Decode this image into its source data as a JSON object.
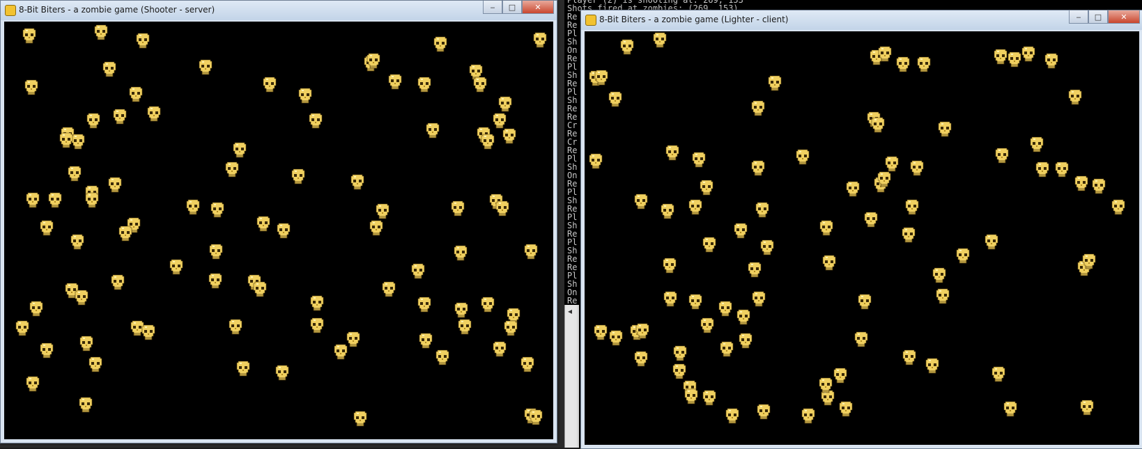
{
  "windows": {
    "server": {
      "title": "8-Bit Biters - a zombie game (Shooter - server)"
    },
    "client": {
      "title": "8-Bit Biters - a zombie game (Lighter - client)"
    },
    "buttons": {
      "minimize": "‒",
      "maximize": "□",
      "close": "✕"
    }
  },
  "console": {
    "lines": [
      "Player (2) is shooting at: 269, 153",
      "Shots fired at zombies: (269, 153)",
      "Re",
      "Re",
      "Pl",
      "Sh",
      "On",
      "Re",
      "Pl",
      "Sh",
      "Re",
      "Pl",
      "Sh",
      "Re",
      "Re",
      "Cr",
      "Re",
      "Cr",
      "Re",
      "Pl",
      "Sh",
      "On",
      "Re",
      "Pl",
      "Sh",
      "Re",
      "Pl",
      "Sh",
      "Re",
      "Pl",
      "Sh",
      "Re",
      "Re",
      "Pl",
      "Sh",
      "On",
      "Re"
    ],
    "scroll_arrow": "◂"
  },
  "colors": {
    "skull": "#f0d060",
    "skull_shade": "#b08a20",
    "canvas": "#000000"
  }
}
